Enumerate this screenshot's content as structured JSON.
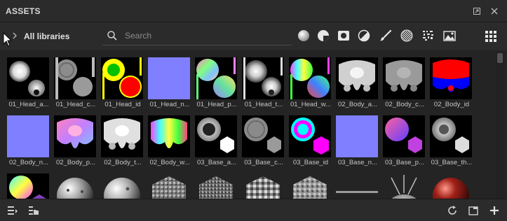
{
  "panel": {
    "title": "ASSETS"
  },
  "library": {
    "label": "All libraries"
  },
  "search": {
    "placeholder": "Search",
    "value": ""
  },
  "filters": [
    "materials-filter-icon",
    "smart-materials-filter-icon",
    "smart-masks-filter-icon",
    "environments-filter-icon",
    "brushes-filter-icon",
    "alphas-filter-icon",
    "procedurals-filter-icon",
    "textures-filter-icon"
  ],
  "assets": [
    "01_Head_a...",
    "01_Head_c...",
    "01_Head_id",
    "01_Head_n...",
    "01_Head_p...",
    "01_Head_t...",
    "01_Head_w...",
    "02_Body_a...",
    "02_Body_c...",
    "02_Body_id",
    "02_Body_n...",
    "02_Body_p...",
    "02_Body_t...",
    "02_Body_w...",
    "03_Base_a...",
    "03_Base_c...",
    "03_Base_id",
    "03_Base_n...",
    "03_Base_p...",
    "03_Base_th...",
    "",
    "",
    "",
    "",
    "",
    "",
    "",
    "",
    "",
    ""
  ],
  "colors": {
    "background": "#262626",
    "panel": "#2b2b2b",
    "normal_map": "#7f7fff",
    "id_red": "#ff0000",
    "id_yellow": "#ffff00",
    "id_green": "#00c000"
  }
}
